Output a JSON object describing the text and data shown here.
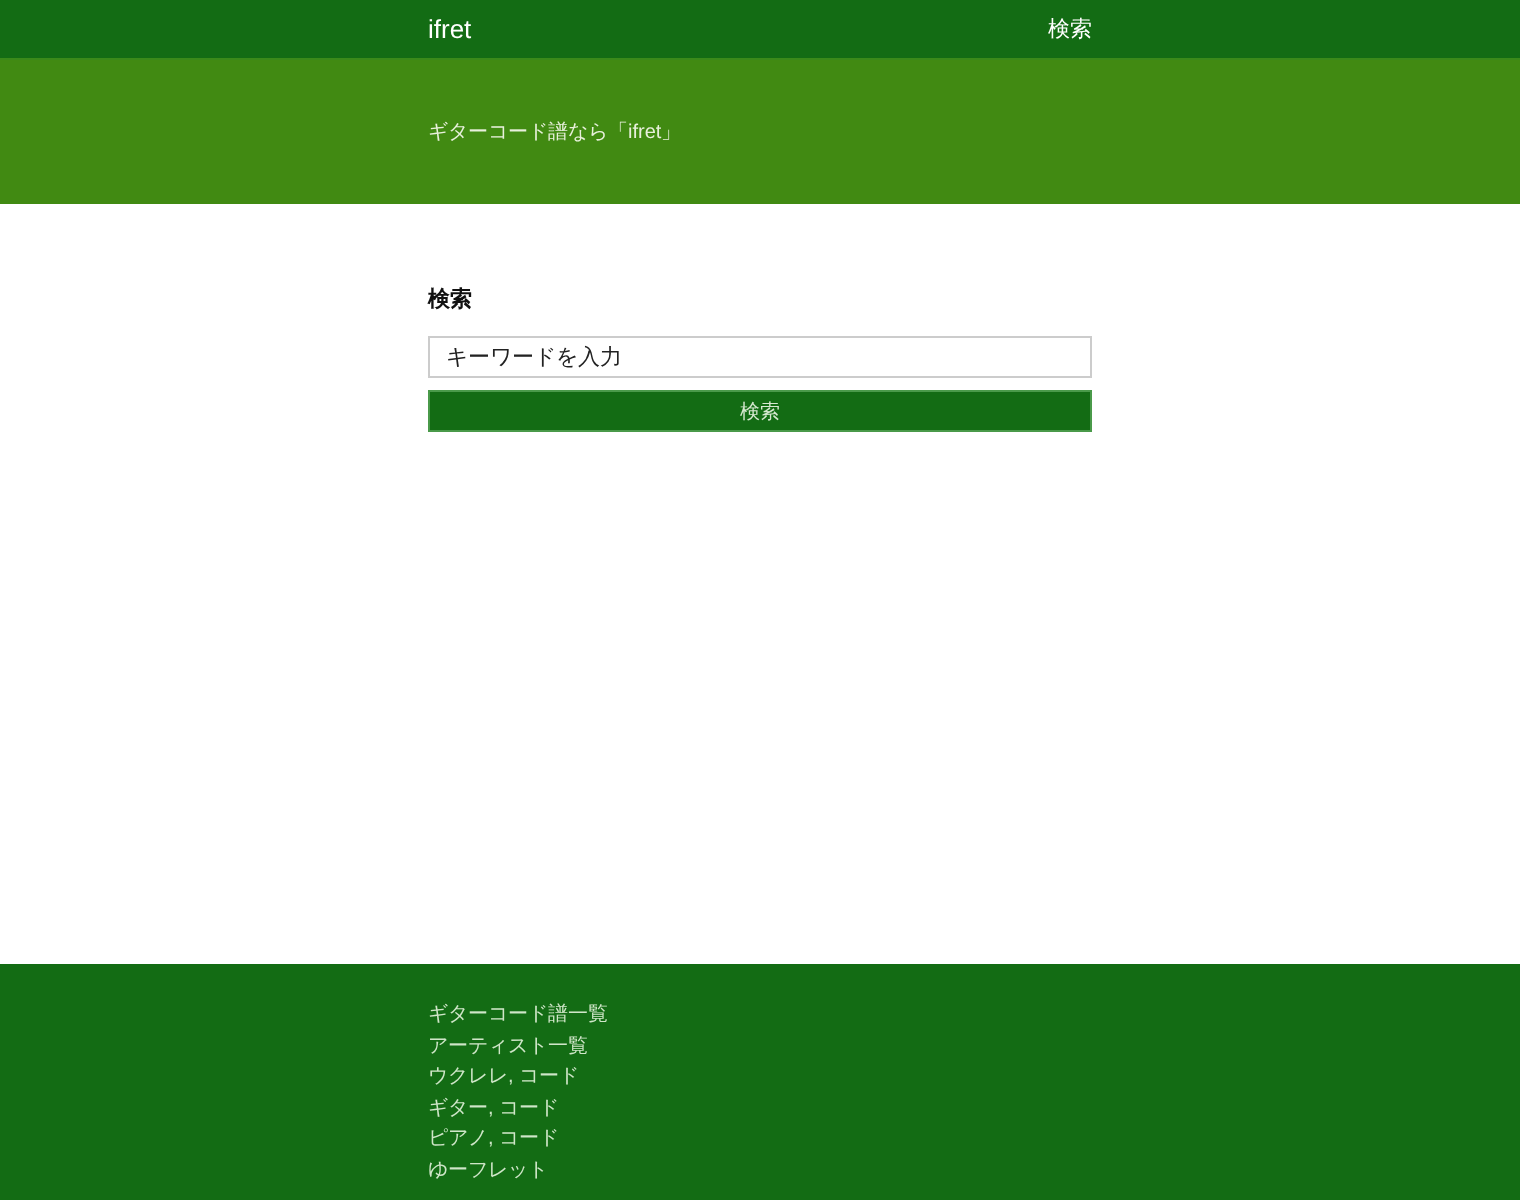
{
  "header": {
    "logo": "ifret",
    "nav_link": "検索"
  },
  "hero": {
    "tagline": "ギターコード譜なら「ifret」"
  },
  "search": {
    "heading": "検索",
    "placeholder": "キーワードを入力",
    "button": "検索"
  },
  "footer": {
    "links": [
      "ギターコード譜一覧",
      "アーティスト一覧",
      "ウクレレ, コード",
      "ギター, コード",
      "ピアノ, コード",
      "ゆーフレット"
    ]
  }
}
